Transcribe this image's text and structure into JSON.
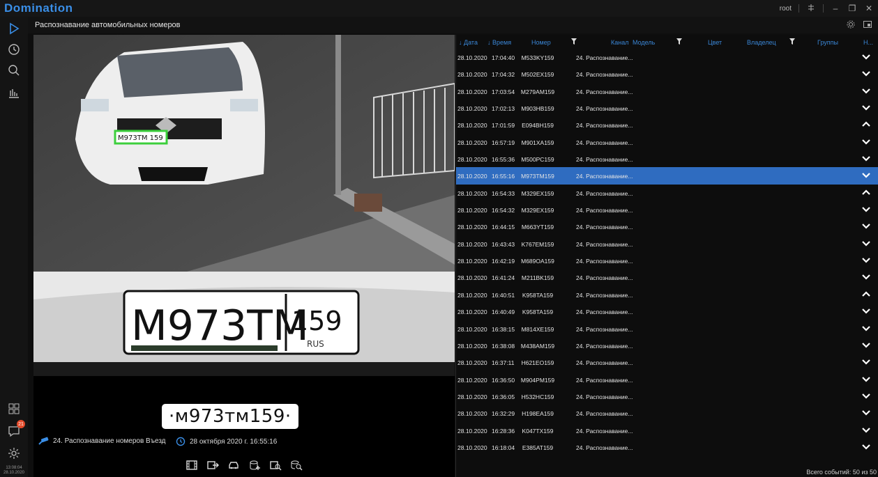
{
  "app": {
    "brand": "Domination",
    "user": "root"
  },
  "header": {
    "title": "Распознавание автомобильных номеров"
  },
  "rail": {
    "clock_time": "13:08:04",
    "clock_date": "28.10.2020",
    "notifications_count": "21"
  },
  "viewer": {
    "plate_text": "·м973тм159·",
    "camera_label": "24. Распознавание номеров Въезд",
    "timestamp": "28 октября 2020 г. 16:55:16",
    "scene_plate": "M973TM 159",
    "crop_plate_main": "M973TM",
    "crop_plate_region": "159",
    "crop_plate_country": "RUS"
  },
  "table": {
    "columns": {
      "date": "Дата",
      "time": "Время",
      "number": "Номер",
      "channel": "Канал",
      "model": "Модель",
      "color": "Цвет",
      "owner": "Владелец",
      "groups": "Группы",
      "last": "Н..."
    },
    "rows": [
      {
        "date": "28.10.2020",
        "time": "17:04:40",
        "number": "M533KY159",
        "channel": "24. Распознавание...",
        "expanded": false
      },
      {
        "date": "28.10.2020",
        "time": "17:04:32",
        "number": "M502EX159",
        "channel": "24. Распознавание...",
        "expanded": false
      },
      {
        "date": "28.10.2020",
        "time": "17:03:54",
        "number": "M279AM159",
        "channel": "24. Распознавание...",
        "expanded": false
      },
      {
        "date": "28.10.2020",
        "time": "17:02:13",
        "number": "M903HB159",
        "channel": "24. Распознавание...",
        "expanded": false
      },
      {
        "date": "28.10.2020",
        "time": "17:01:59",
        "number": "E094BH159",
        "channel": "24. Распознавание...",
        "expanded": true
      },
      {
        "date": "28.10.2020",
        "time": "16:57:19",
        "number": "M901XA159",
        "channel": "24. Распознавание...",
        "expanded": false
      },
      {
        "date": "28.10.2020",
        "time": "16:55:36",
        "number": "M500PC159",
        "channel": "24. Распознавание...",
        "expanded": false
      },
      {
        "date": "28.10.2020",
        "time": "16:55:16",
        "number": "M973TM159",
        "channel": "24. Распознавание...",
        "expanded": false,
        "selected": true
      },
      {
        "date": "28.10.2020",
        "time": "16:54:33",
        "number": "M329EX159",
        "channel": "24. Распознавание...",
        "expanded": true
      },
      {
        "date": "28.10.2020",
        "time": "16:54:32",
        "number": "M329EX159",
        "channel": "24. Распознавание...",
        "expanded": false
      },
      {
        "date": "28.10.2020",
        "time": "16:44:15",
        "number": "M663YT159",
        "channel": "24. Распознавание...",
        "expanded": false
      },
      {
        "date": "28.10.2020",
        "time": "16:43:43",
        "number": "K767EM159",
        "channel": "24. Распознавание...",
        "expanded": false
      },
      {
        "date": "28.10.2020",
        "time": "16:42:19",
        "number": "M689OA159",
        "channel": "24. Распознавание...",
        "expanded": false
      },
      {
        "date": "28.10.2020",
        "time": "16:41:24",
        "number": "M211BK159",
        "channel": "24. Распознавание...",
        "expanded": false
      },
      {
        "date": "28.10.2020",
        "time": "16:40:51",
        "number": "K958TA159",
        "channel": "24. Распознавание...",
        "expanded": true
      },
      {
        "date": "28.10.2020",
        "time": "16:40:49",
        "number": "K958TA159",
        "channel": "24. Распознавание...",
        "expanded": false
      },
      {
        "date": "28.10.2020",
        "time": "16:38:15",
        "number": "M814XE159",
        "channel": "24. Распознавание...",
        "expanded": false
      },
      {
        "date": "28.10.2020",
        "time": "16:38:08",
        "number": "M438AM159",
        "channel": "24. Распознавание...",
        "expanded": false
      },
      {
        "date": "28.10.2020",
        "time": "16:37:11",
        "number": "H621EO159",
        "channel": "24. Распознавание...",
        "expanded": false
      },
      {
        "date": "28.10.2020",
        "time": "16:36:50",
        "number": "M904PM159",
        "channel": "24. Распознавание...",
        "expanded": false
      },
      {
        "date": "28.10.2020",
        "time": "16:36:05",
        "number": "H532HC159",
        "channel": "24. Распознавание...",
        "expanded": false
      },
      {
        "date": "28.10.2020",
        "time": "16:32:29",
        "number": "H198EA159",
        "channel": "24. Распознавание...",
        "expanded": false
      },
      {
        "date": "28.10.2020",
        "time": "16:28:36",
        "number": "K047TX159",
        "channel": "24. Распознавание...",
        "expanded": false
      },
      {
        "date": "28.10.2020",
        "time": "16:18:04",
        "number": "E385AT159",
        "channel": "24. Распознавание...",
        "expanded": false
      }
    ],
    "footer": "Всего событий: 50 из 50"
  },
  "colors": {
    "accent": "#3a8ee6",
    "selected_row": "#2f6cc0",
    "plate_frame": "#3ccf3c",
    "badge": "#e34a2a"
  }
}
